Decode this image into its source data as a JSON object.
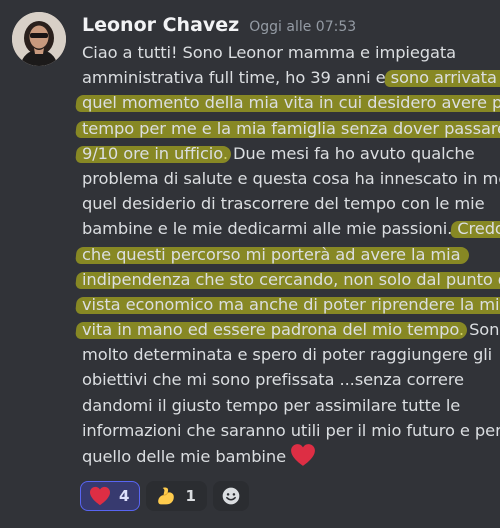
{
  "message": {
    "author": "Leonor Chavez",
    "timestamp": "Oggi alle 07:53",
    "lines": [
      {
        "pre": "Ciao a tutti! Sono Leonor mamma e impiegata",
        "hl": "",
        "post": ""
      },
      {
        "pre": "amministrativa full time, ho 39 anni e ",
        "hl": "sono arrivata a",
        "post": ""
      },
      {
        "pre": "",
        "hl": "quel momento della mia vita in cui desidero avere più",
        "post": ""
      },
      {
        "pre": "",
        "hl": "tempo per me e la mia famiglia senza dover passare",
        "post": ""
      },
      {
        "pre": "",
        "hl": "9/10 ore in ufficio",
        "post": ". Due mesi fa ho avuto qualche"
      },
      {
        "pre": "problema di salute e questa cosa ha innescato in me,",
        "hl": "",
        "post": ""
      },
      {
        "pre": "quel desiderio di trascorrere del tempo con le mie",
        "hl": "",
        "post": ""
      },
      {
        "pre": "bambine e le mie dedicarmi alle mie passioni. ",
        "hl": "Credo",
        "post": ""
      },
      {
        "pre": "",
        "hl": "che questi percorso mi porterà ad avere la mia",
        "post": ""
      },
      {
        "pre": "",
        "hl": "indipendenza che sto cercando,  non solo dal punto di",
        "post": ""
      },
      {
        "pre": "",
        "hl": "vista economico ma anche di poter riprendere la mia",
        "post": ""
      },
      {
        "pre": "",
        "hl": "vita in mano ed essere padrona del mio tempo",
        "post": ". Sono"
      },
      {
        "pre": "molto determinata e spero di poter raggiungere gli",
        "hl": "",
        "post": ""
      },
      {
        "pre": "obiettivi che mi sono prefissata ...senza correre",
        "hl": "",
        "post": ""
      },
      {
        "pre": "dandomi il giusto tempo per assimilare tutte le",
        "hl": "",
        "post": ""
      },
      {
        "pre": "informazioni che saranno utili per il mio futuro e per",
        "hl": "",
        "post": ""
      },
      {
        "pre": "quello delle mie bambine",
        "hl": "",
        "post": ""
      }
    ],
    "trailing_emoji": "red-heart"
  },
  "reactions": [
    {
      "emoji": "red-heart",
      "count": "4",
      "active": true
    },
    {
      "emoji": "flexed-biceps",
      "count": "1",
      "active": false
    },
    {
      "emoji": "add-reaction",
      "count": "",
      "active": false
    }
  ],
  "colors": {
    "background": "#313338",
    "username": "#f2f3f5",
    "timestamp": "#949ba4",
    "text": "#dbdee1",
    "highlight": "#cdcd14",
    "reaction_active_bg": "#373a6f",
    "reaction_active_border": "#5865f2",
    "reaction_bg": "#2b2d31",
    "heart": "#dd2e44"
  }
}
